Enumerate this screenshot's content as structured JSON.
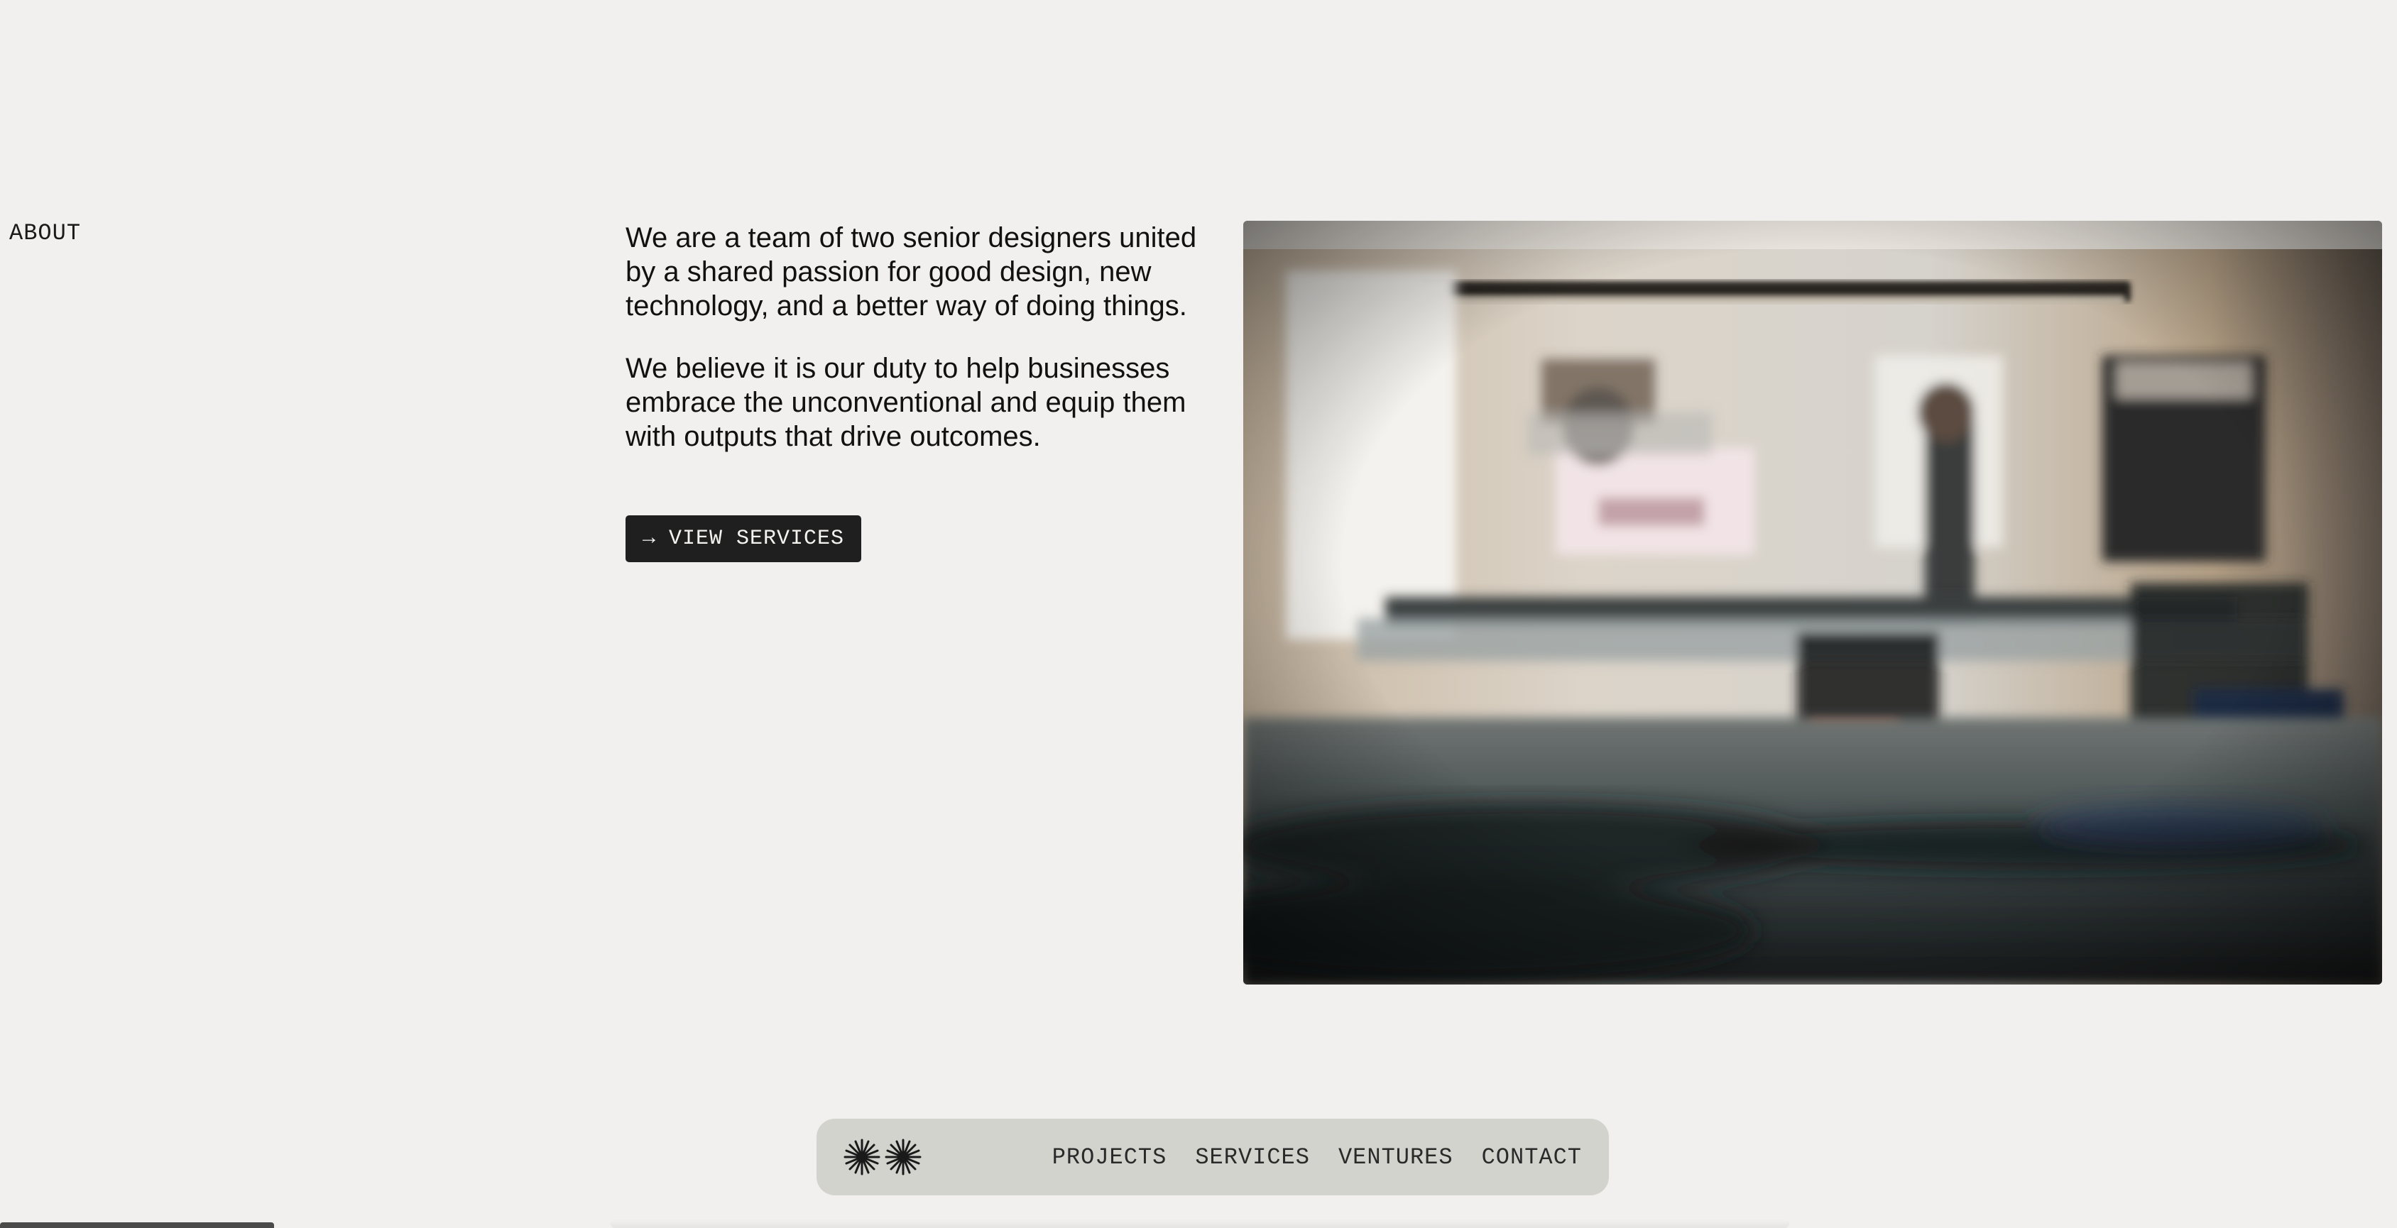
{
  "section": {
    "label": "ABOUT"
  },
  "about": {
    "paragraph_1": "We are a team of two senior designers united by a shared passion for good design, new technology, and a better way of doing things.",
    "paragraph_2": "We believe it is our duty to help businesses embrace the unconventional and equip them with outputs that drive outcomes.",
    "cta_arrow": "→",
    "cta_label": "VIEW SERVICES"
  },
  "photo": {
    "subject": "blurred-office-interior-photo"
  },
  "nav": {
    "logo_icon": "double-starburst-logo-icon",
    "items": [
      {
        "label": "PROJECTS"
      },
      {
        "label": "SERVICES"
      },
      {
        "label": "VENTURES"
      },
      {
        "label": "CONTACT"
      }
    ]
  },
  "colors": {
    "background": "#f1f0ee",
    "button": "#1f1f1f",
    "nav_background": "#d3d3ce",
    "text": "#111111"
  }
}
